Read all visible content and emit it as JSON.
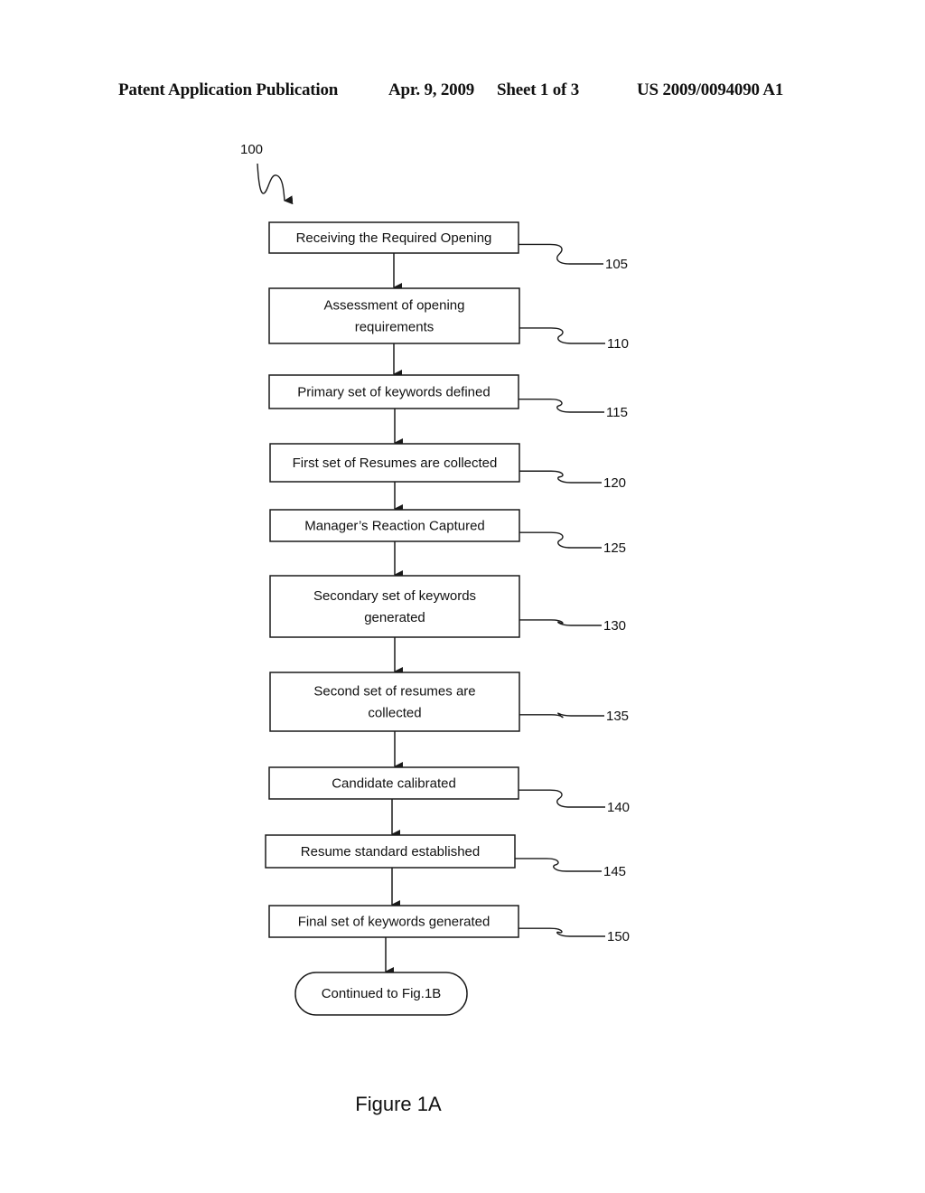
{
  "header": {
    "publication": "Patent Application Publication",
    "date": "Apr. 9, 2009",
    "sheet": "Sheet 1 of 3",
    "number": "US 2009/0094090 A1"
  },
  "diagram": {
    "ref_label": "100",
    "steps": [
      {
        "lines": [
          "Receiving the Required Opening"
        ],
        "ref": "105"
      },
      {
        "lines": [
          "Assessment of opening",
          "requirements"
        ],
        "ref": "110"
      },
      {
        "lines": [
          "Primary set of keywords defined"
        ],
        "ref": "115"
      },
      {
        "lines": [
          "First set of Resumes are collected"
        ],
        "ref": "120"
      },
      {
        "lines": [
          "Manager’s Reaction Captured"
        ],
        "ref": "125"
      },
      {
        "lines": [
          "Secondary set of keywords",
          "generated"
        ],
        "ref": "130"
      },
      {
        "lines": [
          "Second set of resumes are",
          "collected"
        ],
        "ref": "135"
      },
      {
        "lines": [
          "Candidate calibrated"
        ],
        "ref": "140"
      },
      {
        "lines": [
          "Resume standard established"
        ],
        "ref": "145"
      },
      {
        "lines": [
          "Final set of keywords generated"
        ],
        "ref": "150"
      }
    ],
    "terminator": "Continued to Fig.1B",
    "caption": "Figure 1A"
  }
}
